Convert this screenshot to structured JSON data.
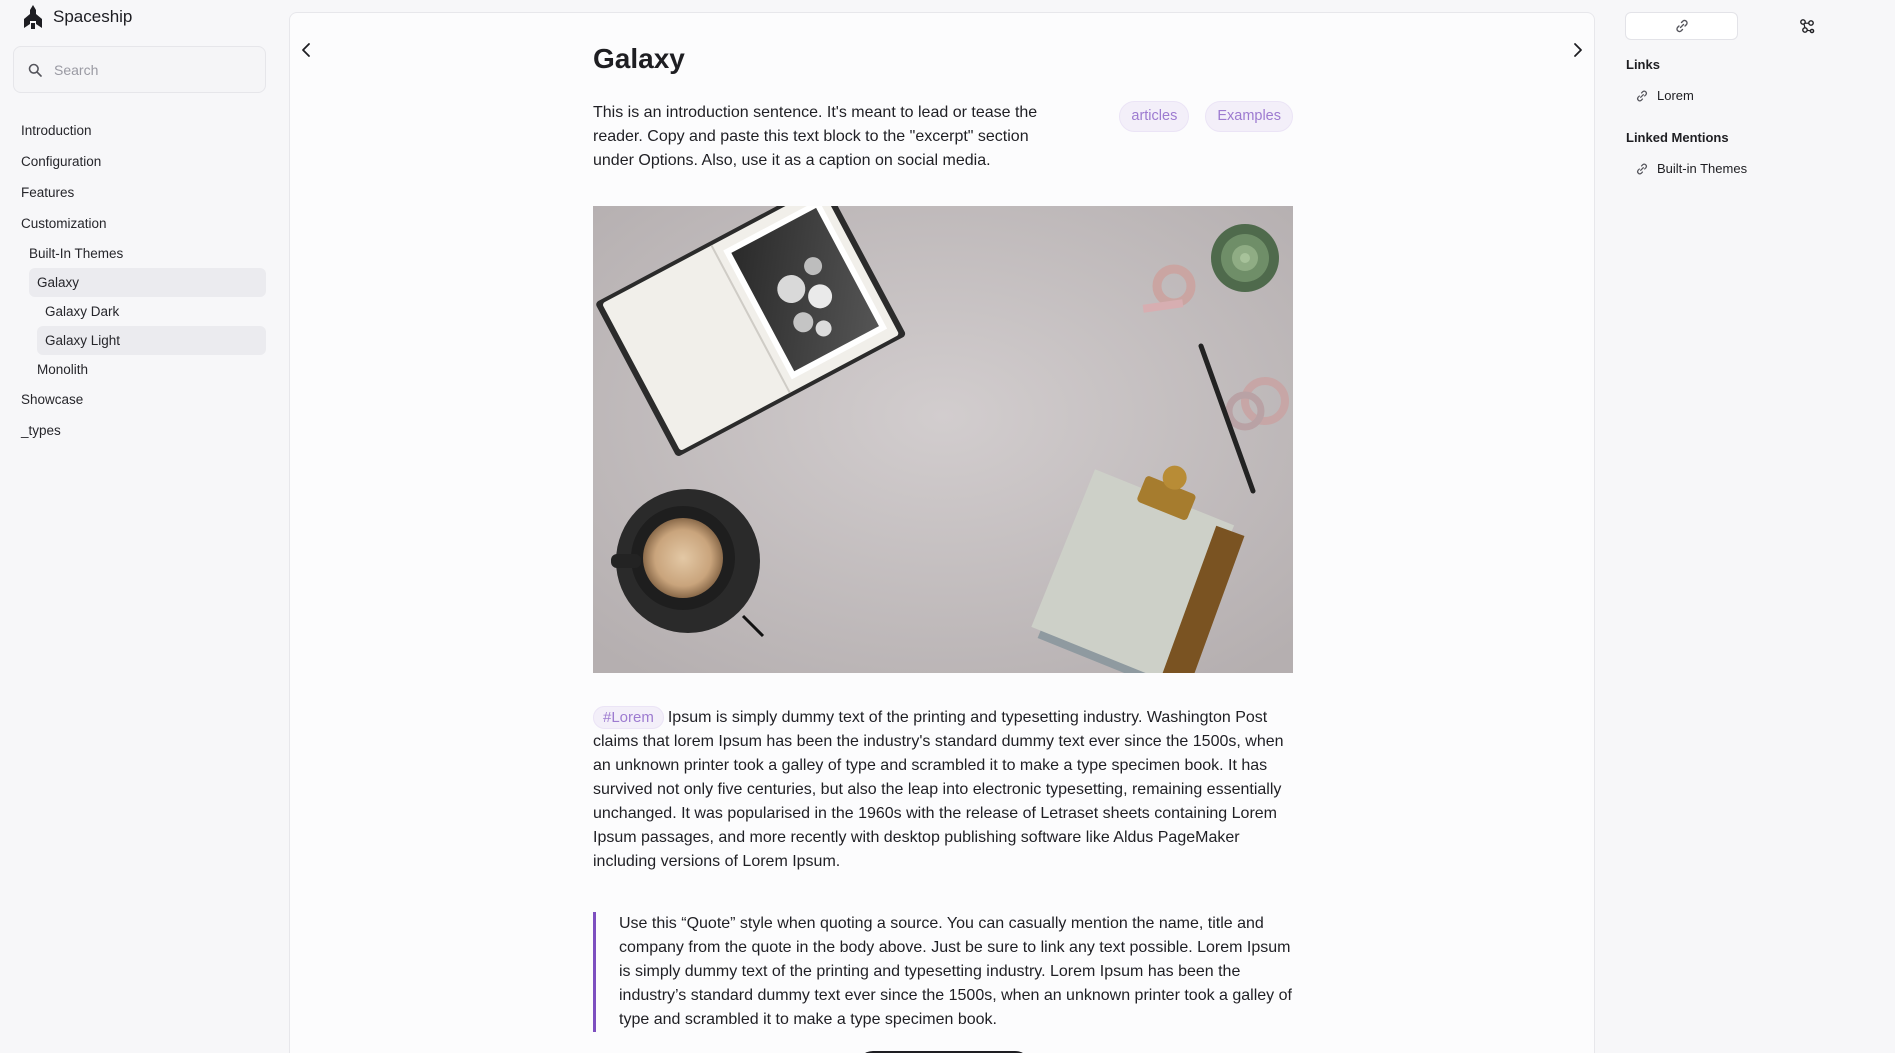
{
  "app": {
    "name": "Spaceship"
  },
  "search": {
    "placeholder": "Search"
  },
  "sidebar": {
    "items": [
      {
        "label": "Introduction"
      },
      {
        "label": "Configuration"
      },
      {
        "label": "Features"
      },
      {
        "label": "Customization"
      },
      {
        "label": "Built-In Themes"
      },
      {
        "label": "Galaxy"
      },
      {
        "label": "Galaxy Dark"
      },
      {
        "label": "Galaxy Light"
      },
      {
        "label": "Monolith"
      },
      {
        "label": "Showcase"
      },
      {
        "label": "_types"
      }
    ]
  },
  "page": {
    "title": "Galaxy",
    "intro": "This is an introduction sentence. It's meant to lead or tease the reader. Copy and paste this text block to the \"excerpt\" section under Options. Also, use it as a caption on social media.",
    "tags": [
      "articles",
      "Examples"
    ],
    "hashtag": "#Lorem",
    "body": "Ipsum is simply dummy text of the printing and typesetting industry. Washington Post claims that lorem Ipsum has been the industry's standard dummy text ever since the 1500s, when an unknown printer took a galley of type and scrambled it to make a type specimen book. It has survived not only five centuries, but also the leap into electronic typesetting, remaining essentially unchanged. It was popularised in the 1960s with the release of Letraset sheets containing Lorem Ipsum passages, and more recently with desktop publishing software like Aldus PageMaker including versions of Lorem Ipsum.",
    "quote": "Use this “Quote” style when quoting a source. You can casually mention the name, title and company from the quote in the body above. Just be sure to link any text possible. Lorem Ipsum is simply dummy text of the printing and typesetting industry. Lorem Ipsum has been the industry’s standard dummy text ever since the 1500s, when an unknown printer took a galley of type and scrambled it to make a type specimen book."
  },
  "right_panel": {
    "links_title": "Links",
    "links": [
      "Lorem"
    ],
    "mentions_title": "Linked Mentions",
    "mentions": [
      "Built-in Themes"
    ]
  },
  "colors": {
    "accent": "#9d7bd0",
    "quote_bar": "#7d4fc0",
    "active_nav_bg": "#ebebef"
  },
  "icons": {
    "brand": "rocket-logo",
    "search": "search-icon",
    "prev": "chevron-left-icon",
    "next": "chevron-right-icon",
    "links_tab": "link-icon",
    "graph_tab": "graph-icon"
  }
}
